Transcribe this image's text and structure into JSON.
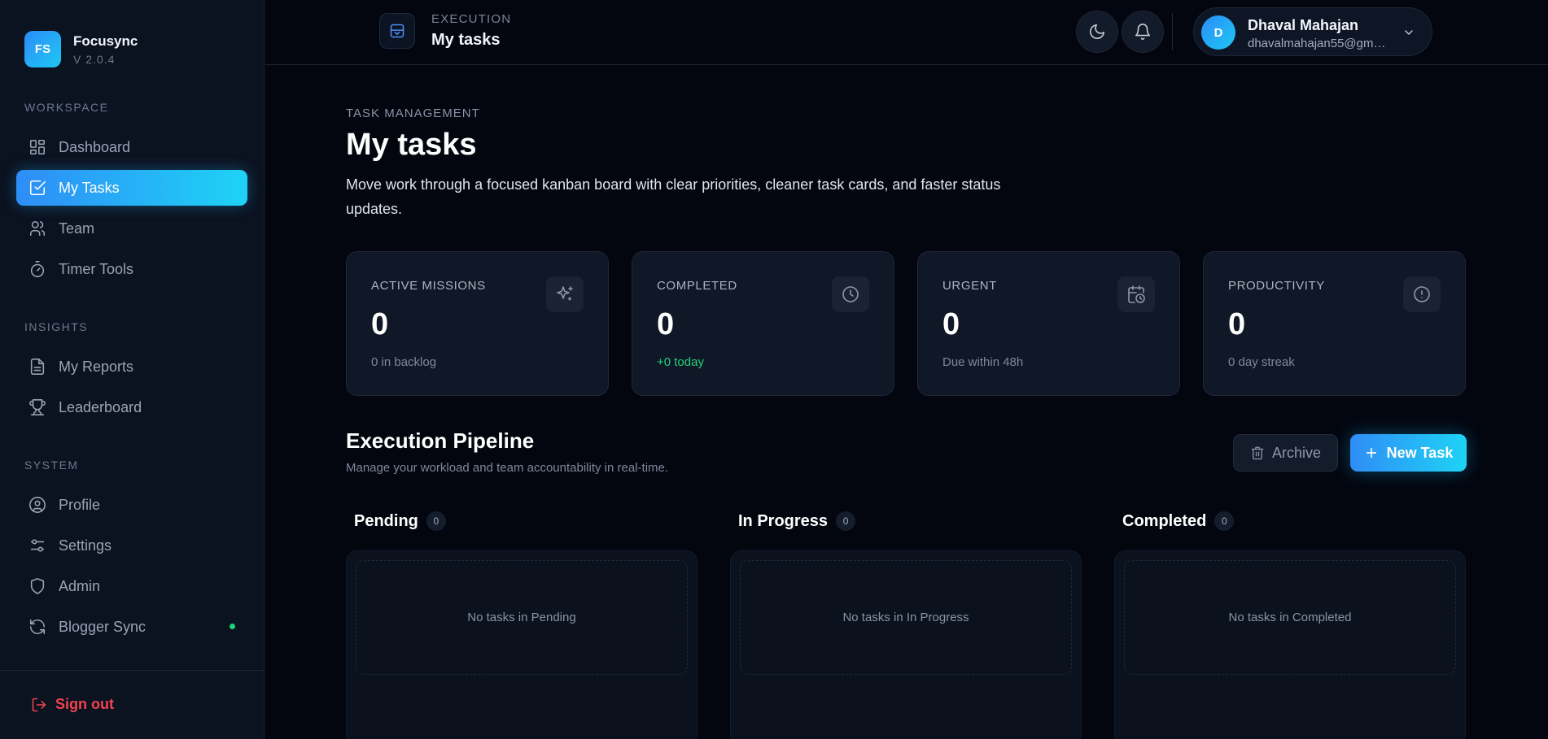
{
  "brand": {
    "logo": "FS",
    "name": "Focusync",
    "version": "V 2.0.4"
  },
  "sidebar": {
    "sections": [
      {
        "label": "WORKSPACE",
        "items": [
          {
            "label": "Dashboard",
            "icon": "dashboard-icon"
          },
          {
            "label": "My Tasks",
            "icon": "check-square-icon",
            "active": true
          },
          {
            "label": "Team",
            "icon": "team-icon"
          },
          {
            "label": "Timer Tools",
            "icon": "timer-icon"
          }
        ]
      },
      {
        "label": "INSIGHTS",
        "items": [
          {
            "label": "My Reports",
            "icon": "report-icon"
          },
          {
            "label": "Leaderboard",
            "icon": "trophy-icon"
          }
        ]
      },
      {
        "label": "SYSTEM",
        "items": [
          {
            "label": "Profile",
            "icon": "profile-icon"
          },
          {
            "label": "Settings",
            "icon": "sliders-icon"
          },
          {
            "label": "Admin",
            "icon": "shield-icon"
          },
          {
            "label": "Blogger Sync",
            "icon": "sync-icon",
            "status": "online"
          }
        ]
      }
    ],
    "signout": "Sign out"
  },
  "header": {
    "eyebrow": "EXECUTION",
    "title": "My tasks",
    "icon": "inbox-icon",
    "user": {
      "initial": "D",
      "name": "Dhaval Mahajan",
      "email": "dhavalmahajan55@gma..."
    }
  },
  "main": {
    "eyebrow": "TASK MANAGEMENT",
    "title": "My tasks",
    "description": "Move work through a focused kanban board with clear priorities, cleaner task cards, and faster status updates.",
    "stats": [
      {
        "label": "ACTIVE MISSIONS",
        "value": "0",
        "sub": "0 in backlog",
        "icon": "sparkles-icon"
      },
      {
        "label": "COMPLETED",
        "value": "0",
        "sub": "+0 today",
        "icon": "clock-icon",
        "sub_color": "#22d07a"
      },
      {
        "label": "URGENT",
        "value": "0",
        "sub": "Due within 48h",
        "icon": "calendar-clock-icon"
      },
      {
        "label": "PRODUCTIVITY",
        "value": "0",
        "sub": "0 day streak",
        "icon": "alert-circle-icon"
      }
    ],
    "pipeline": {
      "title": "Execution Pipeline",
      "subtitle": "Manage your workload and team accountability in real-time.",
      "archive_label": "Archive",
      "new_task_label": "New Task",
      "columns": [
        {
          "title": "Pending",
          "count": "0",
          "empty": "No tasks in Pending"
        },
        {
          "title": "In Progress",
          "count": "0",
          "empty": "No tasks in In Progress"
        },
        {
          "title": "Completed",
          "count": "0",
          "empty": "No tasks in Completed"
        }
      ]
    }
  },
  "colors": {
    "accent": "#2f8df6",
    "accent_end": "#1ed3f5",
    "danger": "#f2434e",
    "success": "#22d07a",
    "background": "#03060f",
    "sidebar": "#0b1220"
  }
}
